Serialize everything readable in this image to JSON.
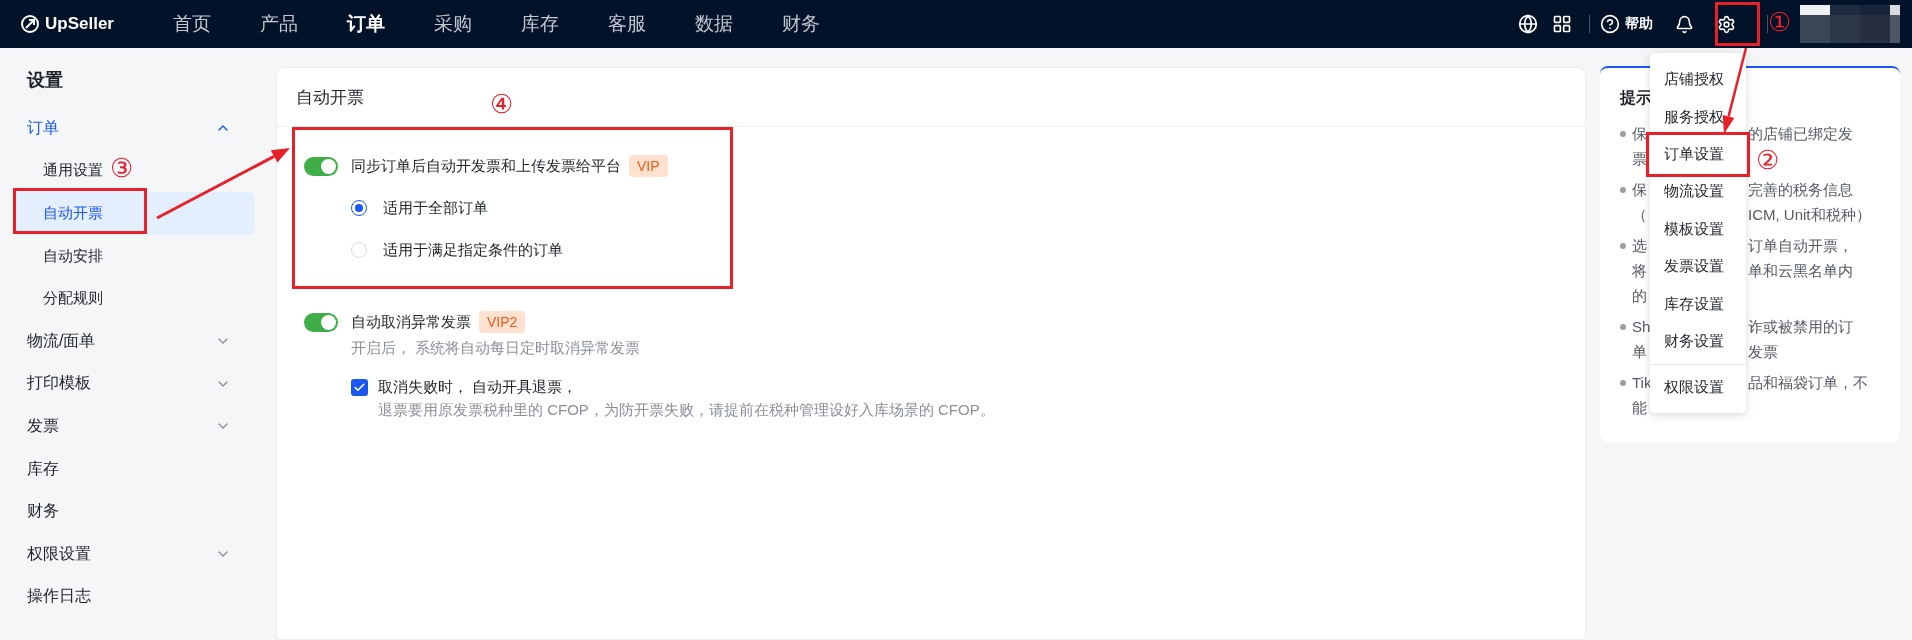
{
  "top_nav": {
    "logo": "UpSeller",
    "items": [
      {
        "label": "首页",
        "selected": false
      },
      {
        "label": "产品",
        "selected": false
      },
      {
        "label": "订单",
        "selected": true
      },
      {
        "label": "采购",
        "selected": false
      },
      {
        "label": "库存",
        "selected": false
      },
      {
        "label": "客服",
        "selected": false
      },
      {
        "label": "数据",
        "selected": false
      },
      {
        "label": "财务",
        "selected": false
      }
    ],
    "help": "帮助"
  },
  "sidebar": {
    "title": "设置",
    "items": [
      {
        "kind": "group",
        "label": "订单",
        "selected": true,
        "expanded": true,
        "children": [
          {
            "label": "通用设置",
            "selected": false
          },
          {
            "label": "自动开票",
            "selected": true
          },
          {
            "label": "自动安排",
            "selected": false
          },
          {
            "label": "分配规则",
            "selected": false
          }
        ]
      },
      {
        "kind": "group",
        "label": "物流/面单",
        "selected": false,
        "expanded": false
      },
      {
        "kind": "group",
        "label": "打印模板",
        "selected": false,
        "expanded": false
      },
      {
        "kind": "group",
        "label": "发票",
        "selected": false,
        "expanded": false
      },
      {
        "kind": "link",
        "label": "库存",
        "selected": false
      },
      {
        "kind": "link",
        "label": "财务",
        "selected": false
      },
      {
        "kind": "group",
        "label": "权限设置",
        "selected": false,
        "expanded": false
      },
      {
        "kind": "link",
        "label": "操作日志",
        "selected": false
      }
    ]
  },
  "page": {
    "title": "自动开票",
    "settings": [
      {
        "label": "同步订单后自动开发票和上传发票给平台",
        "on": true,
        "badge": "VIP",
        "options": [
          {
            "label": "适用于全部订单",
            "selected": true
          },
          {
            "label": "适用于满足指定条件的订单",
            "selected": false
          }
        ]
      },
      {
        "label": "自动取消异常发票",
        "on": true,
        "badge": "VIP2",
        "description": "开启后， 系统将自动每日定时取消异常发票",
        "checkbox": {
          "label": "取消失败时， 自动开具退票，",
          "checked": true,
          "hint": "退票要用原发票税种里的 CFOP，为防开票失败，请提前在税种管理设好入库场景的 CFOP。"
        }
      }
    ]
  },
  "tips": {
    "title": "提示",
    "items": [
      {
        "lines": [
          {
            "left": "保",
            "right": "的店铺已绑定发"
          },
          {
            "left": "票"
          }
        ]
      },
      {
        "lines": [
          {
            "left": "保",
            "right": "完善的税务信息"
          },
          {
            "left": "（",
            "right": "ICM, Unit和税种）"
          }
        ]
      },
      {
        "lines": [
          {
            "left": "选",
            "right": "订单自动开票，"
          },
          {
            "left": "将",
            "right": "单和云黑名单内"
          },
          {
            "left": "的"
          }
        ]
      },
      {
        "lines": [
          {
            "left": "Sh",
            "right": "诈或被禁用的订"
          },
          {
            "left": "单",
            "right": "发票"
          }
        ]
      },
      {
        "lines": [
          {
            "left": "Tik",
            "right": "品和福袋订单，不"
          },
          {
            "left": "能"
          }
        ]
      }
    ]
  },
  "settings_menu": {
    "groups": [
      {
        "items": [
          "店铺授权",
          "服务授权",
          "订单设置",
          "物流设置",
          "模板设置",
          "发票设置",
          "库存设置",
          "财务设置"
        ]
      },
      {
        "items": [
          "权限设置"
        ]
      }
    ]
  },
  "annotations": [
    {
      "label": "①"
    },
    {
      "label": "②"
    },
    {
      "label": "③"
    },
    {
      "label": "④"
    }
  ]
}
